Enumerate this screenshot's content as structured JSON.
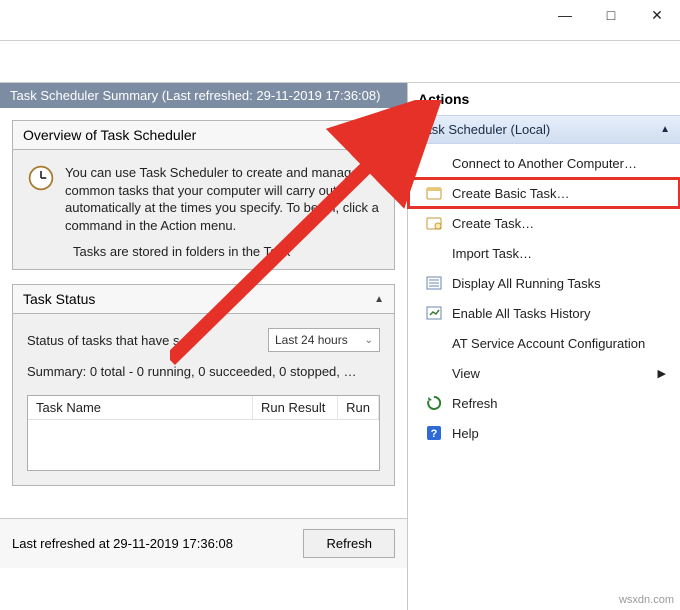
{
  "titlebar": {
    "minimize": "—",
    "maximize": "□",
    "close": "✕"
  },
  "summary": {
    "header": "Task Scheduler Summary (Last refreshed: 29-11-2019 17:36:08)",
    "overview": {
      "title": "Overview of Task Scheduler",
      "text": "You can use Task Scheduler to create and manage common tasks that your computer will carry out automatically at the times you specify. To begin, click a command in the Action menu.",
      "folders_note": "Tasks are stored in folders in the Task"
    },
    "status": {
      "title": "Task Status",
      "label": "Status of tasks that have s…",
      "dropdown_value": "Last 24 hours",
      "line": "Summary: 0 total - 0 running, 0 succeeded, 0 stopped, …",
      "columns": {
        "name": "Task Name",
        "result": "Run Result",
        "run": "Run"
      }
    },
    "bottom": {
      "label": "Last refreshed at 29-11-2019 17:36:08",
      "refresh": "Refresh"
    }
  },
  "actions": {
    "header": "Actions",
    "scope": "Task Scheduler (Local)",
    "items": [
      {
        "label": "Connect to Another Computer…",
        "icon": "none"
      },
      {
        "label": "Create Basic Task…",
        "icon": "basic",
        "highlight": true
      },
      {
        "label": "Create Task…",
        "icon": "task"
      },
      {
        "label": "Import Task…",
        "icon": "none"
      },
      {
        "label": "Display All Running Tasks",
        "icon": "list"
      },
      {
        "label": "Enable All Tasks History",
        "icon": "history"
      },
      {
        "label": "AT Service Account Configuration",
        "icon": "none"
      },
      {
        "label": "View",
        "icon": "none",
        "submenu": true
      },
      {
        "label": "Refresh",
        "icon": "refresh"
      },
      {
        "label": "Help",
        "icon": "help"
      }
    ]
  },
  "source": "wsxdn.com"
}
